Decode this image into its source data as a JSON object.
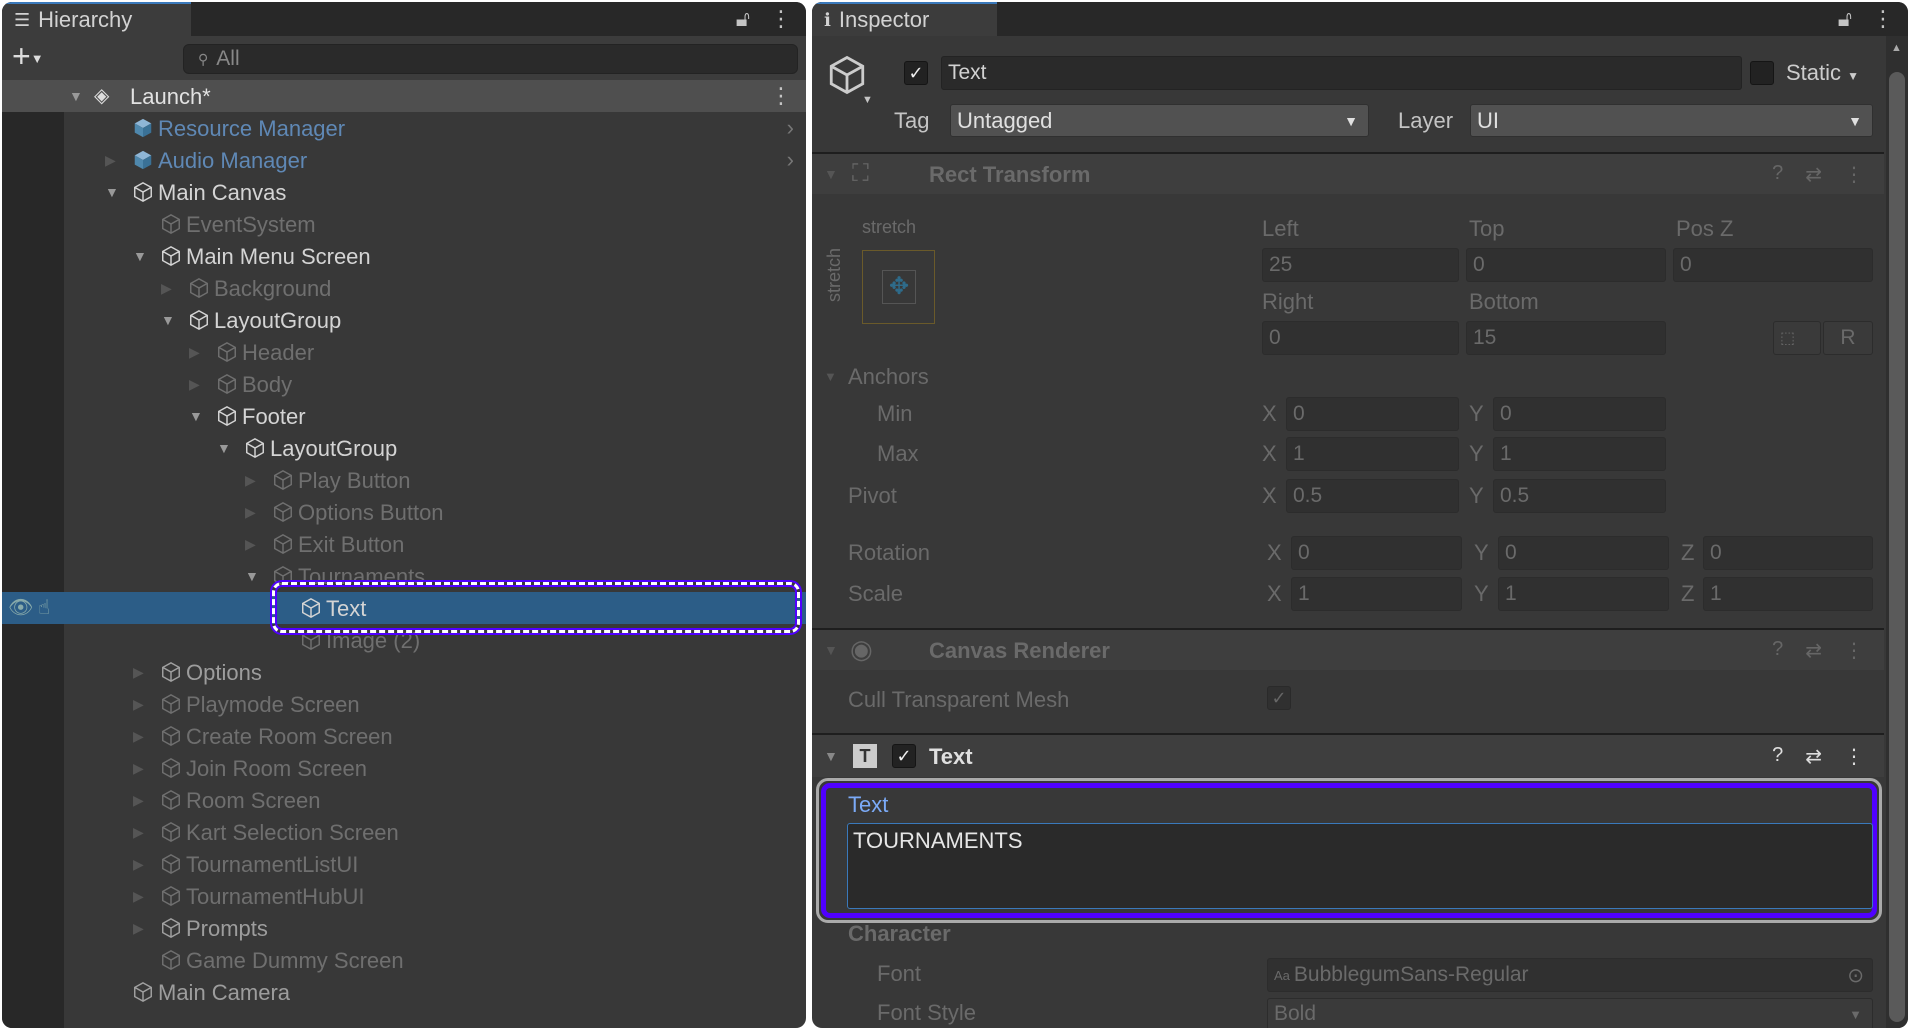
{
  "hierarchy": {
    "tab_label": "Hierarchy",
    "search_placeholder": "All",
    "scene_name": "Launch*",
    "items": [
      {
        "name": "Resource Manager",
        "level": 1,
        "arrow": "none",
        "state": "prefab",
        "chevron": true
      },
      {
        "name": "Audio Manager",
        "level": 1,
        "arrow": "collapsed",
        "state": "prefab",
        "chevron": true
      },
      {
        "name": "Main Canvas",
        "level": 1,
        "arrow": "expanded",
        "state": "active"
      },
      {
        "name": "EventSystem",
        "level": 2,
        "arrow": "none",
        "state": "inactive"
      },
      {
        "name": "Main Menu Screen",
        "level": 2,
        "arrow": "expanded",
        "state": "active"
      },
      {
        "name": "Background",
        "level": 3,
        "arrow": "collapsed",
        "state": "inactive"
      },
      {
        "name": "LayoutGroup",
        "level": 3,
        "arrow": "expanded",
        "state": "active"
      },
      {
        "name": "Header",
        "level": 4,
        "arrow": "collapsed",
        "state": "inactive"
      },
      {
        "name": "Body",
        "level": 4,
        "arrow": "collapsed",
        "state": "inactive"
      },
      {
        "name": "Footer",
        "level": 4,
        "arrow": "expanded",
        "state": "active"
      },
      {
        "name": "LayoutGroup",
        "level": 5,
        "arrow": "expanded",
        "state": "active"
      },
      {
        "name": "Play Button",
        "level": 6,
        "arrow": "collapsed",
        "state": "inactive"
      },
      {
        "name": "Options Button",
        "level": 6,
        "arrow": "collapsed",
        "state": "inactive"
      },
      {
        "name": "Exit Button",
        "level": 6,
        "arrow": "collapsed",
        "state": "inactive"
      },
      {
        "name": "Tournaments",
        "level": 6,
        "arrow": "expanded",
        "state": "inactive"
      },
      {
        "name": "Text",
        "level": 7,
        "arrow": "none",
        "state": "selected"
      },
      {
        "name": "Image (2)",
        "level": 7,
        "arrow": "none",
        "state": "inactive"
      },
      {
        "name": "Options",
        "level": 2,
        "arrow": "collapsed",
        "state": "mid"
      },
      {
        "name": "Playmode Screen",
        "level": 2,
        "arrow": "collapsed",
        "state": "inactive"
      },
      {
        "name": "Create Room Screen",
        "level": 2,
        "arrow": "collapsed",
        "state": "inactive"
      },
      {
        "name": "Join Room Screen",
        "level": 2,
        "arrow": "collapsed",
        "state": "inactive"
      },
      {
        "name": "Room Screen",
        "level": 2,
        "arrow": "collapsed",
        "state": "inactive"
      },
      {
        "name": "Kart Selection Screen",
        "level": 2,
        "arrow": "collapsed",
        "state": "inactive"
      },
      {
        "name": "TournamentListUI",
        "level": 2,
        "arrow": "collapsed",
        "state": "inactive"
      },
      {
        "name": "TournamentHubUI",
        "level": 2,
        "arrow": "collapsed",
        "state": "inactive"
      },
      {
        "name": "Prompts",
        "level": 2,
        "arrow": "collapsed",
        "state": "mid"
      },
      {
        "name": "Game Dummy Screen",
        "level": 2,
        "arrow": "none",
        "state": "inactive"
      },
      {
        "name": "Main Camera",
        "level": 1,
        "arrow": "none",
        "state": "mid"
      }
    ]
  },
  "inspector": {
    "tab_label": "Inspector",
    "object_name": "Text",
    "active": true,
    "static_label": "Static",
    "tag_label": "Tag",
    "tag_value": "Untagged",
    "layer_label": "Layer",
    "layer_value": "UI",
    "rect_transform": {
      "title": "Rect Transform",
      "preset_h": "stretch",
      "preset_v": "stretch",
      "left_label": "Left",
      "left": "25",
      "top_label": "Top",
      "top": "0",
      "posz_label": "Pos Z",
      "posz": "0",
      "right_label": "Right",
      "right": "0",
      "bottom_label": "Bottom",
      "bottom": "15",
      "r_button": "R",
      "anchors_label": "Anchors",
      "min_label": "Min",
      "min_x": "0",
      "min_y": "0",
      "max_label": "Max",
      "max_x": "1",
      "max_y": "1",
      "pivot_label": "Pivot",
      "pivot_x": "0.5",
      "pivot_y": "0.5",
      "rotation_label": "Rotation",
      "rot_x": "0",
      "rot_y": "0",
      "rot_z": "0",
      "scale_label": "Scale",
      "scale_x": "1",
      "scale_y": "1",
      "scale_z": "1",
      "x": "X",
      "y": "Y",
      "z": "Z"
    },
    "canvas_renderer": {
      "title": "Canvas Renderer",
      "cull_label": "Cull Transparent Mesh",
      "cull": true
    },
    "text_component": {
      "title": "Text",
      "enabled": true,
      "text_label": "Text",
      "text_value": "TOURNAMENTS",
      "character_label": "Character",
      "font_label": "Font",
      "font_value": "BubblegumSans-Regular",
      "font_prefix": "Aa",
      "font_style_label": "Font Style",
      "font_style_value": "Bold"
    }
  },
  "colors": {
    "selection": "#2c5d87",
    "highlight": "#5000ff",
    "prefab": "#5f88b5",
    "label_blue": "#7baaf7"
  }
}
